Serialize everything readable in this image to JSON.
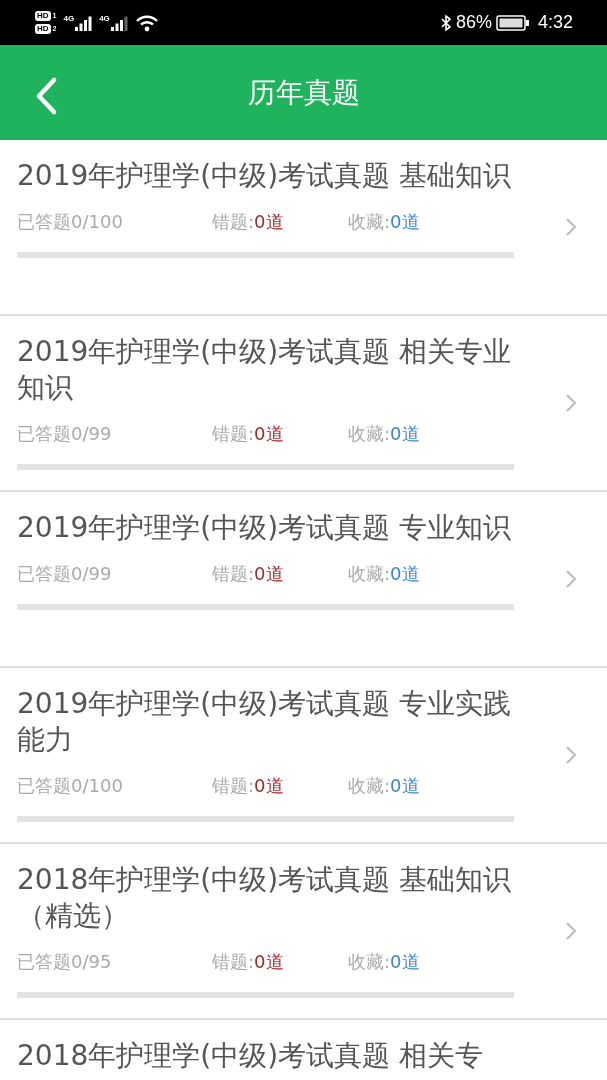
{
  "status_bar": {
    "sims": [
      {
        "badge": "HD",
        "slot": "1",
        "network": "4G"
      },
      {
        "badge": "HD",
        "slot": "2",
        "network": "4G"
      }
    ],
    "battery": "86%",
    "time": "4:32"
  },
  "header": {
    "title": "历年真题"
  },
  "items": [
    {
      "title": "2019年护理学(中级)考试真题 基础知识",
      "answered": "已答题0/100",
      "wrong_label": "错题:",
      "wrong_value": "0道",
      "fav_label": "收藏:",
      "fav_value": "0道",
      "level": 0
    },
    {
      "title": "2019年护理学(中级)考试真题 相关专业知识",
      "answered": "已答题0/99",
      "wrong_label": "错题:",
      "wrong_value": "0道",
      "fav_label": "收藏:",
      "fav_value": "0道",
      "level": 0
    },
    {
      "title": "2019年护理学(中级)考试真题 专业知识",
      "answered": "已答题0/99",
      "wrong_label": "错题:",
      "wrong_value": "0道",
      "fav_label": "收藏:",
      "fav_value": "0道",
      "level": 0
    },
    {
      "title": "2019年护理学(中级)考试真题 专业实践能力",
      "answered": "已答题0/100",
      "wrong_label": "错题:",
      "wrong_value": "0道",
      "fav_label": "收藏:",
      "fav_value": "0道",
      "level": 0
    },
    {
      "title": "2018年护理学(中级)考试真题 基础知识（精选）",
      "answered": "已答题0/95",
      "wrong_label": "错题:",
      "wrong_value": "0道",
      "fav_label": "收藏:",
      "fav_value": "0道",
      "level": 0
    },
    {
      "title": "2018年护理学(中级)考试真题 相关专"
    }
  ]
}
